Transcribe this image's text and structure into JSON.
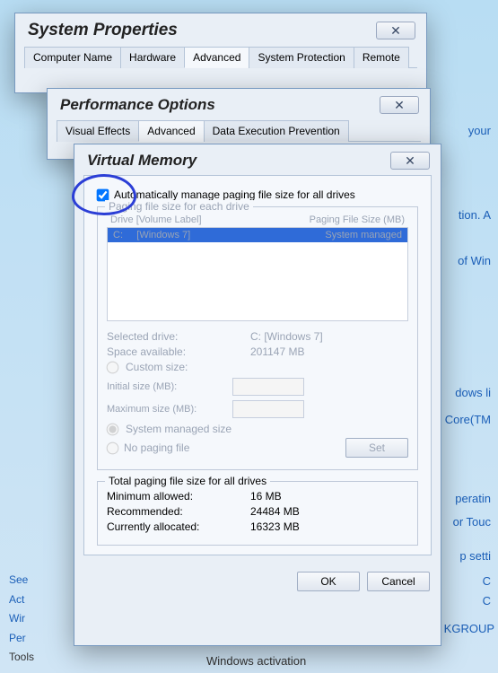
{
  "sysprops": {
    "title": "System Properties",
    "tabs": [
      "Computer Name",
      "Hardware",
      "Advanced",
      "System Protection",
      "Remote"
    ],
    "active_tab": 2
  },
  "perf": {
    "title": "Performance Options",
    "tabs": [
      "Visual Effects",
      "Advanced",
      "Data Execution Prevention"
    ],
    "active_tab": 1
  },
  "vm": {
    "title": "Virtual Memory",
    "auto_label": "Automatically manage paging file size for all drives",
    "auto_checked": true,
    "group_each": "Paging file size for each drive",
    "col_drive": "Drive  [Volume Label]",
    "col_size": "Paging File Size (MB)",
    "drive_row": {
      "drive": "C:",
      "label": "[Windows 7]",
      "size": "System managed"
    },
    "selected_drive_k": "Selected drive:",
    "selected_drive_v": "C:  [Windows 7]",
    "space_k": "Space available:",
    "space_v": "201147 MB",
    "custom": "Custom size:",
    "initial": "Initial size (MB):",
    "maximum": "Maximum size (MB):",
    "sys_managed": "System managed size",
    "no_paging": "No paging file",
    "set": "Set",
    "group_total": "Total paging file size for all drives",
    "min_k": "Minimum allowed:",
    "min_v": "16 MB",
    "rec_k": "Recommended:",
    "rec_v": "24484 MB",
    "cur_k": "Currently allocated:",
    "cur_v": "16323 MB",
    "ok": "OK",
    "cancel": "Cancel"
  },
  "bg": {
    "your": "your",
    "tion": "tion.  A",
    "ofwin": "of Win",
    "dows": "dows li",
    "coretm": "Core(TM",
    "perati": "peratin",
    "ortouc": "or Touc",
    "psetti": "p setti",
    "c1": "C",
    "c2": "C",
    "kgroup": "KGROUP",
    "winact": "Windows activation"
  },
  "sidebar": {
    "see": "See",
    "act": "Act",
    "wir": "Wir",
    "per": "Per",
    "tools": "Tools"
  }
}
